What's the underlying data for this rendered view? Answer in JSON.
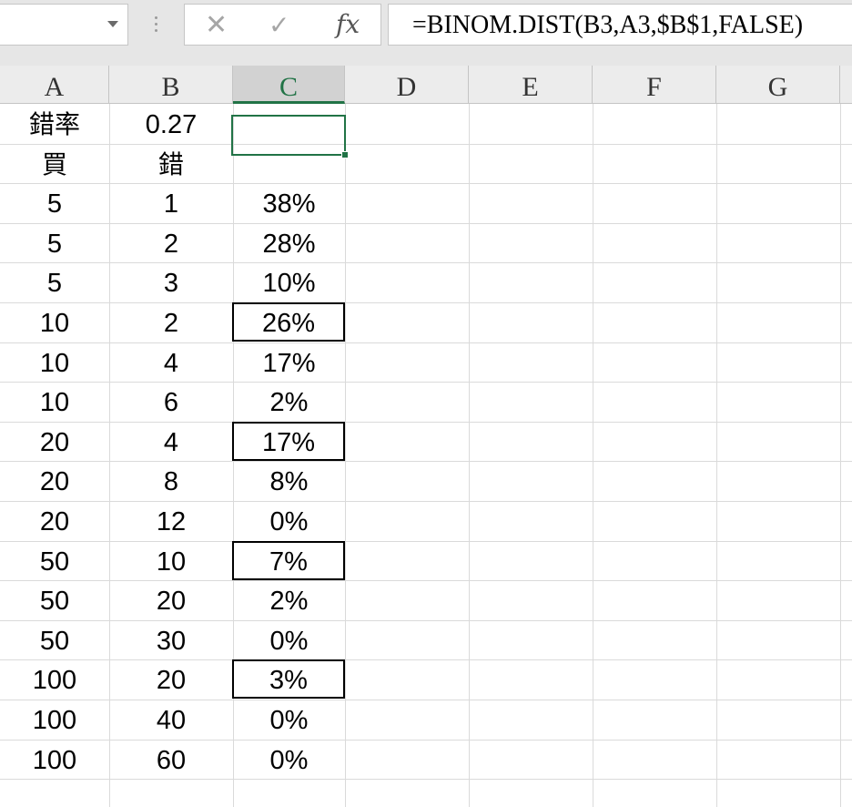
{
  "name_box": {
    "value": ""
  },
  "formula_bar": {
    "cancel_glyph": "✕",
    "enter_glyph": "✓",
    "fx_label": "fx",
    "formula": "=BINOM.DIST(B3,A3,$B$1,FALSE)"
  },
  "columns": [
    "A",
    "B",
    "C",
    "D",
    "E",
    "F",
    "G"
  ],
  "selected_column": "C",
  "rows": [
    {
      "a": "錯率",
      "b": "0.27",
      "c": ""
    },
    {
      "a": "買",
      "b": "錯",
      "c": ""
    },
    {
      "a": "5",
      "b": "1",
      "c": "38%"
    },
    {
      "a": "5",
      "b": "2",
      "c": "28%"
    },
    {
      "a": "5",
      "b": "3",
      "c": "10%"
    },
    {
      "a": "10",
      "b": "2",
      "c": "26%"
    },
    {
      "a": "10",
      "b": "4",
      "c": "17%"
    },
    {
      "a": "10",
      "b": "6",
      "c": "2%"
    },
    {
      "a": "20",
      "b": "4",
      "c": "17%"
    },
    {
      "a": "20",
      "b": "8",
      "c": "8%"
    },
    {
      "a": "20",
      "b": "12",
      "c": "0%"
    },
    {
      "a": "50",
      "b": "10",
      "c": "7%"
    },
    {
      "a": "50",
      "b": "20",
      "c": "2%"
    },
    {
      "a": "50",
      "b": "30",
      "c": "0%"
    },
    {
      "a": "100",
      "b": "20",
      "c": "3%"
    },
    {
      "a": "100",
      "b": "40",
      "c": "0%"
    },
    {
      "a": "100",
      "b": "60",
      "c": "0%"
    }
  ],
  "colors": {
    "accent": "#217346",
    "header_bg": "#ececec",
    "gridline": "#dadada"
  }
}
